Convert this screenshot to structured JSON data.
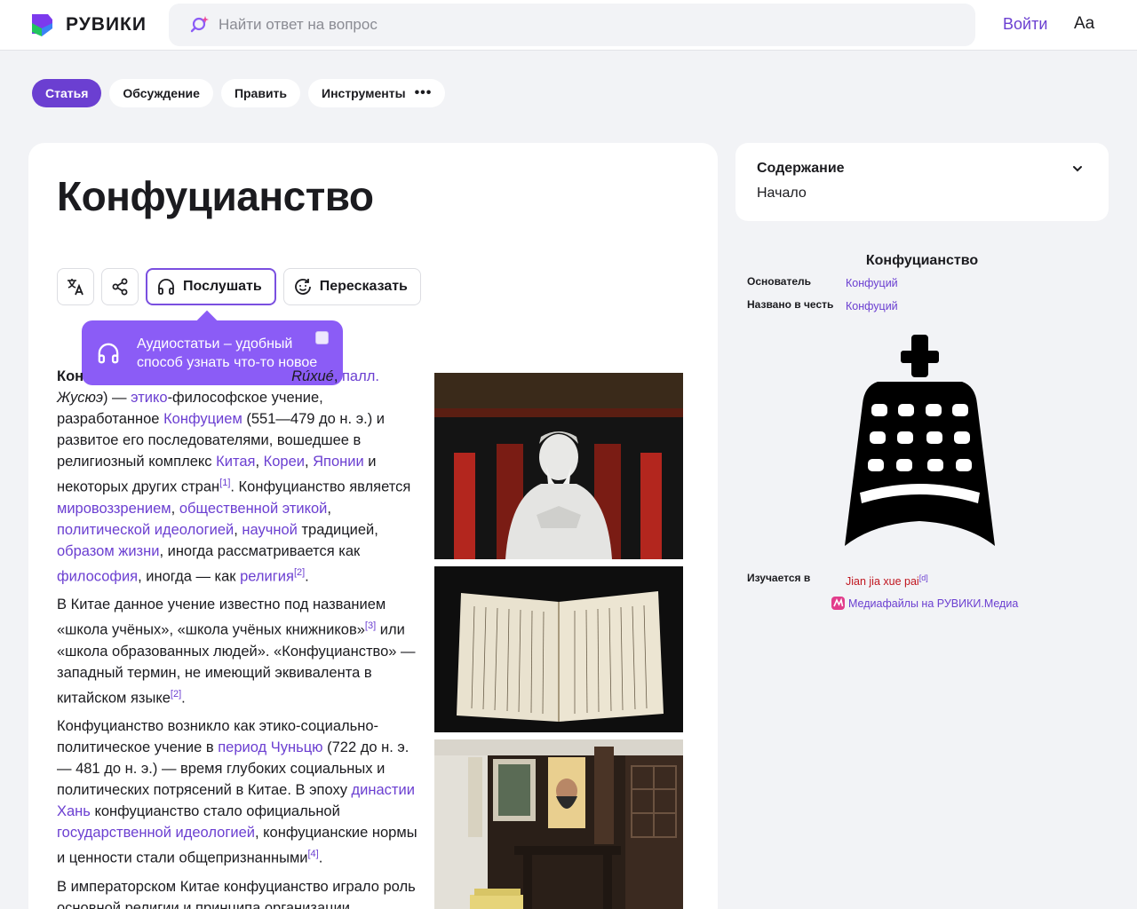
{
  "header": {
    "logo_text": "РУВИКИ",
    "search_placeholder": "Найти ответ на вопрос",
    "login_label": "Войти",
    "font_button_label": "Aa"
  },
  "tabs": [
    {
      "label": "Статья",
      "active": true
    },
    {
      "label": "Обсуждение",
      "active": false
    },
    {
      "label": "Править",
      "active": false
    },
    {
      "label": "Инструменты",
      "active": false,
      "more": "•••"
    }
  ],
  "article": {
    "title": "Конфуцианство",
    "actions": {
      "translate_icon": "translate-icon",
      "share_icon": "share-icon",
      "listen_label": "Послушать",
      "retell_label": "Пересказать"
    },
    "tooltip": {
      "text": "Аудиостатьи – удобный способ узнать что-то новое"
    }
  },
  "toc": {
    "title": "Содержание",
    "items": [
      "Начало"
    ]
  },
  "infobox": {
    "title": "Конфуцианство",
    "rows": [
      {
        "label": "Основатель",
        "value": "Конфуций"
      },
      {
        "label": "Названо в честь",
        "value": "Конфуций"
      },
      {
        "label": "Изучается в",
        "value": "Jian jia xue pai",
        "sup": "[d]"
      }
    ],
    "media_link": "Медиафайлы на РУВИКИ.Медиа"
  },
  "colors": {
    "accent": "#6b3fd1",
    "tooltip_bg": "#8b5cf6",
    "red_link": "#c0161f"
  }
}
